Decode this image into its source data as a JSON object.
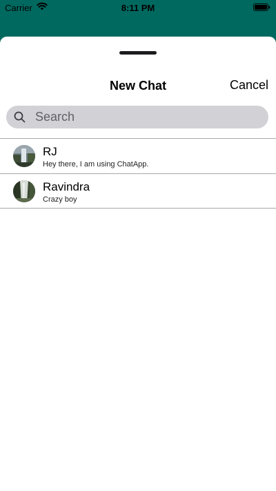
{
  "status_bar": {
    "carrier": "Carrier",
    "time": "8:11 PM",
    "icons": [
      "wifi-icon",
      "battery-icon"
    ]
  },
  "colors": {
    "header_bg": "#00695f",
    "sheet_bg": "#ffffff",
    "search_bg": "#d1d1d6"
  },
  "header": {
    "title": "New Chat",
    "cancel_label": "Cancel"
  },
  "search": {
    "placeholder": "Search",
    "value": ""
  },
  "contacts": [
    {
      "name": "RJ",
      "status": "Hey there, I am using ChatApp.",
      "avatar": "avatar-waterfall"
    },
    {
      "name": "Ravindra",
      "status": "Crazy boy",
      "avatar": "avatar-waterfall-dark"
    }
  ]
}
